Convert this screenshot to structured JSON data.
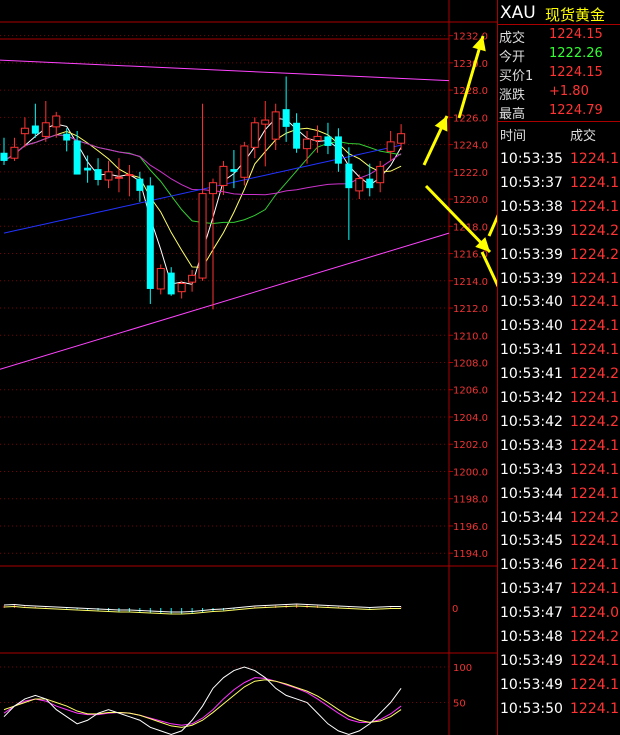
{
  "quote_panel": {
    "symbol": "XAU",
    "name": "现货黄金",
    "rows": [
      {
        "label": "成交",
        "value": "1224.15",
        "color": "#ff3333"
      },
      {
        "label": "今开",
        "value": "1222.26",
        "color": "#33ff33"
      },
      {
        "label": "买价1",
        "value": "1224.15",
        "color": "#ff3333"
      },
      {
        "label": "涨跌",
        "value": "+1.80",
        "color": "#ff3333"
      },
      {
        "label": "最高",
        "value": "1224.79",
        "color": "#ff3333"
      }
    ]
  },
  "tick_table": {
    "header_time": "时间",
    "header_price": "成交",
    "rows": [
      {
        "time": "10:53:35",
        "price": "1224.1"
      },
      {
        "time": "10:53:37",
        "price": "1224.1"
      },
      {
        "time": "10:53:38",
        "price": "1224.1"
      },
      {
        "time": "10:53:39",
        "price": "1224.2"
      },
      {
        "time": "10:53:39",
        "price": "1224.2"
      },
      {
        "time": "10:53:39",
        "price": "1224.1"
      },
      {
        "time": "10:53:40",
        "price": "1224.1"
      },
      {
        "time": "10:53:40",
        "price": "1224.1"
      },
      {
        "time": "10:53:41",
        "price": "1224.1"
      },
      {
        "time": "10:53:41",
        "price": "1224.2"
      },
      {
        "time": "10:53:42",
        "price": "1224.1"
      },
      {
        "time": "10:53:42",
        "price": "1224.2"
      },
      {
        "time": "10:53:43",
        "price": "1224.1"
      },
      {
        "time": "10:53:43",
        "price": "1224.1"
      },
      {
        "time": "10:53:44",
        "price": "1224.1"
      },
      {
        "time": "10:53:44",
        "price": "1224.2"
      },
      {
        "time": "10:53:45",
        "price": "1224.1"
      },
      {
        "time": "10:53:46",
        "price": "1224.1"
      },
      {
        "time": "10:53:47",
        "price": "1224.1"
      },
      {
        "time": "10:53:47",
        "price": "1224.0"
      },
      {
        "time": "10:53:48",
        "price": "1224.2"
      },
      {
        "time": "10:53:49",
        "price": "1224.1"
      },
      {
        "time": "10:53:49",
        "price": "1224.1"
      },
      {
        "time": "10:53:50",
        "price": "1224.1"
      }
    ]
  },
  "colors": {
    "up": "#ff3333",
    "down": "#00ffff",
    "ma_white": "#ffffff",
    "ma_yellow": "#ffff66",
    "ma_green": "#33cc33",
    "ma_magenta": "#cc33cc",
    "ma_blue": "#2233ff",
    "trendline": "#ff44ff",
    "arrow": "#ffff00"
  },
  "chart_data": {
    "type": "candlestick",
    "price_ticks": [
      "1232.0",
      "1230.0",
      "1228.0",
      "1226.0",
      "1224.0",
      "1222.0",
      "1220.0",
      "1218.0",
      "1216.0",
      "1214.0",
      "1212.0",
      "1210.0",
      "1208.0",
      "1206.0",
      "1204.0",
      "1202.0",
      "1200.0",
      "1198.0",
      "1196.0",
      "1194.0"
    ],
    "ylim": [
      1193.5,
      1233.0
    ],
    "candles": [
      {
        "o": 1223.4,
        "h": 1224.5,
        "l": 1222.5,
        "c": 1222.8
      },
      {
        "o": 1223.0,
        "h": 1224.5,
        "l": 1222.8,
        "c": 1223.8
      },
      {
        "o": 1224.8,
        "h": 1226.0,
        "l": 1223.8,
        "c": 1225.2
      },
      {
        "o": 1225.4,
        "h": 1227.0,
        "l": 1224.5,
        "c": 1224.8
      },
      {
        "o": 1224.6,
        "h": 1227.2,
        "l": 1224.2,
        "c": 1225.6
      },
      {
        "o": 1225.3,
        "h": 1226.4,
        "l": 1224.5,
        "c": 1226.1
      },
      {
        "o": 1224.8,
        "h": 1225.2,
        "l": 1223.5,
        "c": 1224.3
      },
      {
        "o": 1224.3,
        "h": 1225.0,
        "l": 1221.8,
        "c": 1221.8
      },
      {
        "o": 1222.3,
        "h": 1223.2,
        "l": 1221.2,
        "c": 1222.1
      },
      {
        "o": 1222.2,
        "h": 1223.0,
        "l": 1221.0,
        "c": 1221.4
      },
      {
        "o": 1221.4,
        "h": 1222.8,
        "l": 1220.8,
        "c": 1222.0
      },
      {
        "o": 1221.6,
        "h": 1223.0,
        "l": 1220.5,
        "c": 1221.6
      },
      {
        "o": 1221.8,
        "h": 1222.5,
        "l": 1220.2,
        "c": 1221.8
      },
      {
        "o": 1221.5,
        "h": 1222.0,
        "l": 1219.8,
        "c": 1220.6
      },
      {
        "o": 1221.0,
        "h": 1221.6,
        "l": 1212.3,
        "c": 1213.4
      },
      {
        "o": 1213.4,
        "h": 1215.2,
        "l": 1213.0,
        "c": 1214.9
      },
      {
        "o": 1214.6,
        "h": 1215.0,
        "l": 1212.9,
        "c": 1213.0
      },
      {
        "o": 1213.2,
        "h": 1214.0,
        "l": 1212.7,
        "c": 1213.8
      },
      {
        "o": 1213.9,
        "h": 1214.8,
        "l": 1213.2,
        "c": 1214.4
      },
      {
        "o": 1214.2,
        "h": 1227.0,
        "l": 1214.0,
        "c": 1220.4
      },
      {
        "o": 1220.4,
        "h": 1221.5,
        "l": 1211.9,
        "c": 1221.2
      },
      {
        "o": 1221.0,
        "h": 1222.8,
        "l": 1220.3,
        "c": 1222.4
      },
      {
        "o": 1222.2,
        "h": 1223.6,
        "l": 1220.8,
        "c": 1222.0
      },
      {
        "o": 1221.6,
        "h": 1224.2,
        "l": 1221.0,
        "c": 1223.9
      },
      {
        "o": 1223.8,
        "h": 1226.0,
        "l": 1223.0,
        "c": 1225.6
      },
      {
        "o": 1225.5,
        "h": 1227.2,
        "l": 1222.4,
        "c": 1225.8
      },
      {
        "o": 1224.4,
        "h": 1227.0,
        "l": 1223.6,
        "c": 1226.4
      },
      {
        "o": 1226.6,
        "h": 1229.0,
        "l": 1224.2,
        "c": 1225.3
      },
      {
        "o": 1225.6,
        "h": 1226.3,
        "l": 1223.4,
        "c": 1223.7
      },
      {
        "o": 1223.7,
        "h": 1225.0,
        "l": 1222.6,
        "c": 1224.4
      },
      {
        "o": 1224.3,
        "h": 1225.4,
        "l": 1223.4,
        "c": 1224.6
      },
      {
        "o": 1224.6,
        "h": 1225.6,
        "l": 1223.3,
        "c": 1223.9
      },
      {
        "o": 1224.6,
        "h": 1225.2,
        "l": 1222.0,
        "c": 1222.6
      },
      {
        "o": 1222.6,
        "h": 1223.8,
        "l": 1217.0,
        "c": 1220.8
      },
      {
        "o": 1220.6,
        "h": 1221.8,
        "l": 1220.0,
        "c": 1221.5
      },
      {
        "o": 1221.5,
        "h": 1222.6,
        "l": 1220.2,
        "c": 1220.8
      },
      {
        "o": 1221.2,
        "h": 1222.8,
        "l": 1220.5,
        "c": 1222.4
      },
      {
        "o": 1223.5,
        "h": 1225.0,
        "l": 1222.8,
        "c": 1224.2
      },
      {
        "o": 1224.1,
        "h": 1225.5,
        "l": 1223.6,
        "c": 1224.8
      }
    ],
    "macd_label": "0",
    "macd_hist": [
      0.4,
      0.5,
      0.3,
      0.2,
      0.1,
      0.0,
      -0.1,
      -0.2,
      -0.3,
      -0.4,
      -0.5,
      -0.6,
      -0.6,
      -0.7,
      -0.8,
      -0.9,
      -1.0,
      -1.0,
      -0.9,
      -0.7,
      -0.5,
      -0.4,
      -0.2,
      0.0,
      0.2,
      0.3,
      0.4,
      0.5,
      0.6,
      0.5,
      0.4,
      0.3,
      0.2,
      0.1,
      0.0,
      -0.1,
      0.0,
      0.1,
      0.1
    ],
    "kdj_ticks": [
      "100",
      "50",
      "0"
    ],
    "kdj_k": [
      30,
      45,
      55,
      60,
      55,
      40,
      30,
      20,
      25,
      35,
      40,
      35,
      30,
      25,
      15,
      10,
      5,
      10,
      25,
      45,
      70,
      85,
      95,
      100,
      95,
      85,
      70,
      60,
      55,
      50,
      35,
      20,
      10,
      5,
      10,
      20,
      35,
      50,
      70
    ],
    "kdj_d": [
      40,
      45,
      50,
      55,
      55,
      50,
      45,
      38,
      34,
      34,
      36,
      36,
      35,
      32,
      27,
      22,
      17,
      15,
      18,
      25,
      36,
      48,
      60,
      72,
      80,
      82,
      80,
      76,
      71,
      66,
      59,
      50,
      40,
      31,
      25,
      22,
      24,
      30,
      40
    ],
    "kdj_j": [
      35,
      45,
      52,
      55,
      52,
      45,
      40,
      35,
      33,
      33,
      35,
      36,
      35,
      32,
      28,
      24,
      20,
      18,
      20,
      28,
      40,
      55,
      68,
      78,
      85,
      84,
      80,
      75,
      70,
      64,
      55,
      45,
      35,
      26,
      22,
      22,
      26,
      34,
      45
    ]
  }
}
